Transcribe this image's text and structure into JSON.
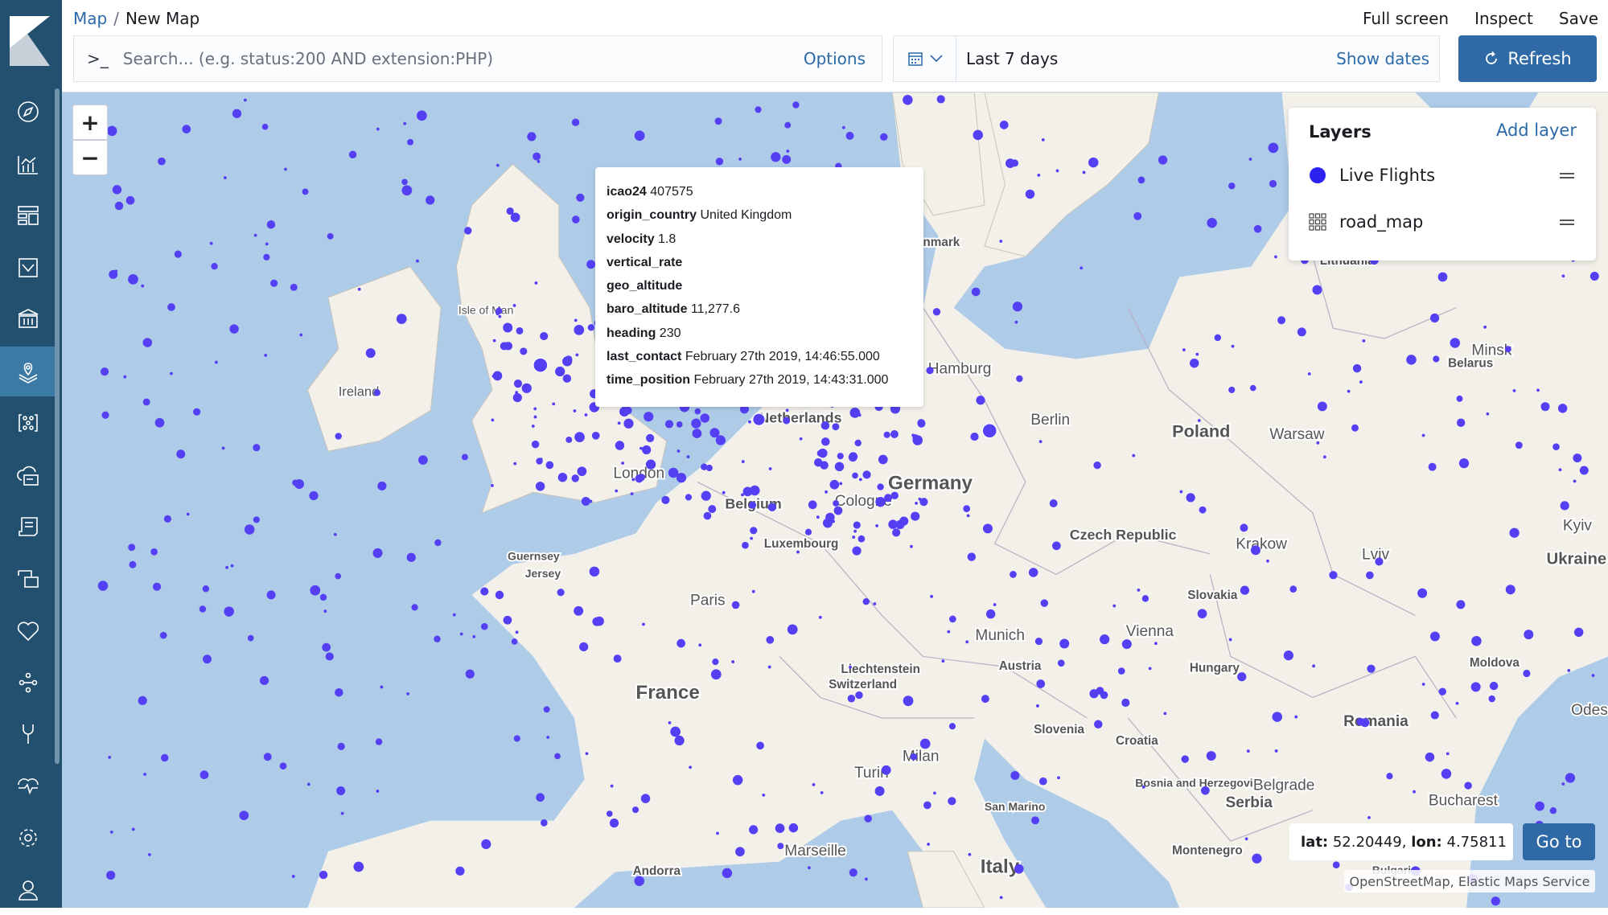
{
  "breadcrumb": {
    "root": "Map",
    "separator": "/",
    "current": "New Map"
  },
  "top_links": {
    "full_screen": "Full screen",
    "inspect": "Inspect",
    "save": "Save"
  },
  "search": {
    "prompt": ">_",
    "placeholder": "Search... (e.g. status:200 AND extension:PHP)",
    "value": "",
    "options_label": "Options"
  },
  "date_picker": {
    "value": "Last 7 days",
    "show_dates": "Show dates"
  },
  "refresh_label": "Refresh",
  "sidebar": {
    "items": [
      "discover",
      "visualize",
      "dashboard",
      "canvas",
      "infrastructure",
      "maps",
      "machine-learning",
      "apm",
      "logs",
      "uptime",
      "graph",
      "dev-tools",
      "monitoring",
      "management",
      "user"
    ],
    "active": "maps"
  },
  "zoom": {
    "in": "+",
    "out": "−"
  },
  "tooltip": {
    "rows": [
      {
        "key": "icao24",
        "value": "407575"
      },
      {
        "key": "origin_country",
        "value": "United Kingdom"
      },
      {
        "key": "velocity",
        "value": "1.8"
      },
      {
        "key": "vertical_rate",
        "value": ""
      },
      {
        "key": "geo_altitude",
        "value": ""
      },
      {
        "key": "baro_altitude",
        "value": "11,277.6"
      },
      {
        "key": "heading",
        "value": "230"
      },
      {
        "key": "last_contact",
        "value": "February 27th 2019, 14:46:55.000"
      },
      {
        "key": "time_position",
        "value": "February 27th 2019, 14:43:31.000"
      }
    ]
  },
  "layers": {
    "title": "Layers",
    "add_label": "Add layer",
    "items": [
      {
        "name": "Live Flights",
        "icon": "circle-icon",
        "color": "#2b22f0"
      },
      {
        "name": "road_map",
        "icon": "grid-icon"
      }
    ]
  },
  "coordinates": {
    "lat_label": "lat:",
    "lat": "52.20449",
    "lon_label": "lon:",
    "lon": "4.75811",
    "goto_label": "Go to"
  },
  "attribution": "OpenStreetMap, Elastic Maps Service",
  "map_labels": [
    "Ireland",
    "Isle of Man",
    "London",
    "Netherlands",
    "Belgium",
    "Hamburg",
    "Berlin",
    "Poland",
    "Warsaw",
    "Germany",
    "Cologne",
    "Luxembourg",
    "Paris",
    "France",
    "Guernsey",
    "Jersey",
    "Czech Republic",
    "Krakow",
    "Lviv",
    "Ukraine",
    "Kyiv",
    "Slovakia",
    "Vienna",
    "Munich",
    "Austria",
    "Hungary",
    "Liechtenstein",
    "Switzerland",
    "Moldova",
    "Romania",
    "Slovenia",
    "Croatia",
    "Milan",
    "Turin",
    "Bosnia and Herzegovina",
    "Serbia",
    "Belgrade",
    "Bucharest",
    "San Marino",
    "Italy",
    "Marseille",
    "Andorra",
    "Montenegro",
    "Minsk",
    "Belarus",
    "Odes",
    "nmark",
    "Lithuania",
    "Bulgaria"
  ],
  "colors": {
    "sidebar": "#24506f",
    "accent": "#2f6aa7",
    "flight_point": "#5440f2",
    "sea": "#aecbe8",
    "land": "#f3f0ea"
  }
}
